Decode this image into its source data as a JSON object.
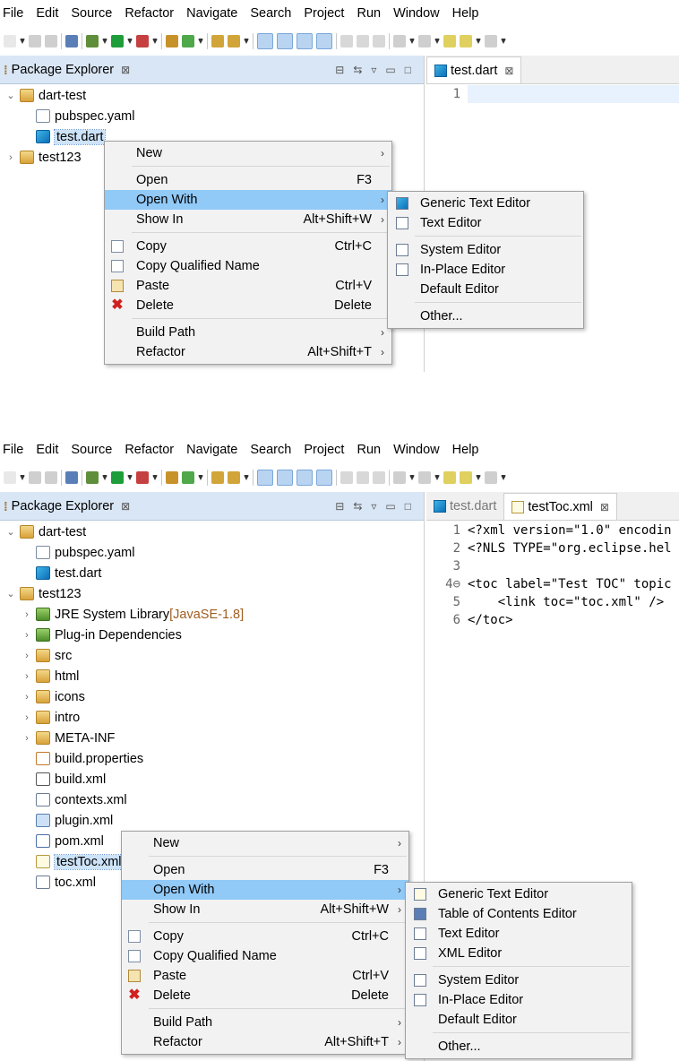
{
  "menubar": [
    "File",
    "Edit",
    "Source",
    "Refactor",
    "Navigate",
    "Search",
    "Project",
    "Run",
    "Window",
    "Help"
  ],
  "shotA": {
    "explorer": {
      "title": "Package Explorer",
      "items": [
        {
          "label": "dart-test",
          "icon": "open-folder-icon",
          "twisty": "expanded"
        },
        {
          "label": "pubspec.yaml",
          "icon": "file-icon"
        },
        {
          "label": "test.dart",
          "icon": "dart-file-icon",
          "selected": true
        },
        {
          "label": "test123",
          "icon": "plugin-project-icon",
          "twisty": "collapsed"
        }
      ]
    },
    "editor": {
      "tabs": [
        {
          "label": "test.dart",
          "active": true
        }
      ],
      "lines": [
        {
          "num": "1",
          "text": ""
        }
      ]
    },
    "context_menu": [
      {
        "label": "New",
        "submenu": true
      },
      {
        "sep": true
      },
      {
        "label": "Open",
        "shortcut": "F3"
      },
      {
        "label": "Open With",
        "submenu": true,
        "highlight": true
      },
      {
        "label": "Show In",
        "shortcut": "Alt+Shift+W",
        "submenu": true
      },
      {
        "sep": true
      },
      {
        "label": "Copy",
        "shortcut": "Ctrl+C",
        "icon": "copy-icon"
      },
      {
        "label": "Copy Qualified Name",
        "icon": "copy-qualified-icon"
      },
      {
        "label": "Paste",
        "shortcut": "Ctrl+V",
        "icon": "paste-icon"
      },
      {
        "label": "Delete",
        "shortcut": "Delete",
        "icon": "delete-icon"
      },
      {
        "sep": true
      },
      {
        "label": "Build Path",
        "submenu": true
      },
      {
        "label": "Refactor",
        "shortcut": "Alt+Shift+T",
        "submenu": true
      }
    ],
    "submenu": [
      {
        "label": "Generic Text Editor",
        "icon": "dart-icon"
      },
      {
        "label": "Text Editor",
        "icon": "text-file-icon"
      },
      {
        "sep": true
      },
      {
        "label": "System Editor",
        "icon": "text-file-icon"
      },
      {
        "label": "In-Place Editor",
        "icon": "text-file-icon"
      },
      {
        "label": "Default Editor"
      },
      {
        "sep": true
      },
      {
        "label": "Other..."
      }
    ]
  },
  "shotB": {
    "explorer": {
      "title": "Package Explorer",
      "items": [
        {
          "label": "dart-test",
          "icon": "open-folder-icon",
          "twisty": "expanded"
        },
        {
          "label": "pubspec.yaml",
          "icon": "file-icon"
        },
        {
          "label": "test.dart",
          "icon": "dart-file-icon"
        },
        {
          "label": "test123",
          "icon": "plugin-project-icon",
          "twisty": "expanded"
        },
        {
          "label": "JRE System Library",
          "decoration": "[JavaSE-1.8]",
          "icon": "library-icon",
          "twisty": "collapsed"
        },
        {
          "label": "Plug-in Dependencies",
          "icon": "library-icon",
          "twisty": "collapsed"
        },
        {
          "label": "src",
          "icon": "source-folder-icon",
          "twisty": "collapsed"
        },
        {
          "label": "html",
          "icon": "folder-icon",
          "twisty": "collapsed"
        },
        {
          "label": "icons",
          "icon": "folder-icon",
          "twisty": "collapsed"
        },
        {
          "label": "intro",
          "icon": "folder-icon",
          "twisty": "collapsed"
        },
        {
          "label": "META-INF",
          "icon": "folder-icon",
          "twisty": "collapsed"
        },
        {
          "label": "build.properties",
          "icon": "properties-file-icon"
        },
        {
          "label": "build.xml",
          "icon": "ant-file-icon"
        },
        {
          "label": "contexts.xml",
          "icon": "xml-file-icon"
        },
        {
          "label": "plugin.xml",
          "icon": "plugin-xml-icon"
        },
        {
          "label": "pom.xml",
          "icon": "maven-file-icon"
        },
        {
          "label": "testToc.xml",
          "icon": "toc-file-icon",
          "selected": true
        },
        {
          "label": "toc.xml",
          "icon": "xml-file-icon"
        }
      ]
    },
    "editor": {
      "tabs": [
        {
          "label": "test.dart",
          "active": false
        },
        {
          "label": "testToc.xml",
          "active": true
        }
      ],
      "lines": [
        {
          "num": "1",
          "text": "<?xml version=\"1.0\" encodin"
        },
        {
          "num": "2",
          "text": "<?NLS TYPE=\"org.eclipse.hel"
        },
        {
          "num": "3",
          "text": ""
        },
        {
          "num": "4⊖",
          "text": "<toc label=\"Test TOC\" topic"
        },
        {
          "num": "5",
          "text": "    <link toc=\"toc.xml\" />"
        },
        {
          "num": "6",
          "text": "</toc>"
        }
      ]
    },
    "context_menu": [
      {
        "label": "New",
        "submenu": true
      },
      {
        "sep": true
      },
      {
        "label": "Open",
        "shortcut": "F3"
      },
      {
        "label": "Open With",
        "submenu": true,
        "highlight": true
      },
      {
        "label": "Show In",
        "shortcut": "Alt+Shift+W",
        "submenu": true
      },
      {
        "sep": true
      },
      {
        "label": "Copy",
        "shortcut": "Ctrl+C",
        "icon": "copy-icon"
      },
      {
        "label": "Copy Qualified Name",
        "icon": "copy-qualified-icon"
      },
      {
        "label": "Paste",
        "shortcut": "Ctrl+V",
        "icon": "paste-icon"
      },
      {
        "label": "Delete",
        "shortcut": "Delete",
        "icon": "delete-icon"
      },
      {
        "sep": true
      },
      {
        "label": "Build Path",
        "submenu": true
      },
      {
        "label": "Refactor",
        "shortcut": "Alt+Shift+T",
        "submenu": true
      }
    ],
    "submenu": [
      {
        "label": "Generic Text Editor",
        "icon": "toc-icon"
      },
      {
        "label": "Table of Contents Editor",
        "icon": "book-icon"
      },
      {
        "label": "Text Editor",
        "icon": "text-file-icon"
      },
      {
        "label": "XML Editor",
        "icon": "xml-editor-icon"
      },
      {
        "sep": true
      },
      {
        "label": "System Editor",
        "icon": "text-file-icon"
      },
      {
        "label": "In-Place Editor",
        "icon": "text-file-icon"
      },
      {
        "label": "Default Editor"
      },
      {
        "sep": true
      },
      {
        "label": "Other..."
      }
    ]
  },
  "colors": {
    "menu_highlight": "#91c9f7",
    "view_tab": "#d9e6f5",
    "decoration": "#a05d20"
  }
}
